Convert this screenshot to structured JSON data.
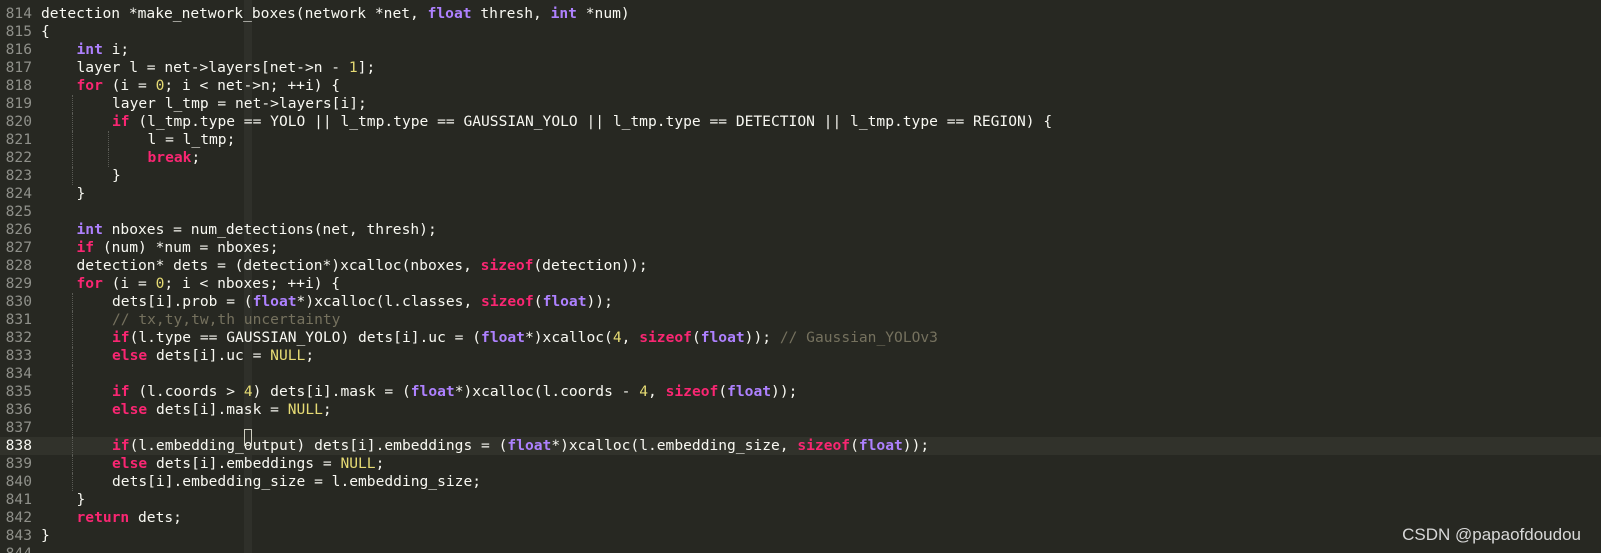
{
  "editor": {
    "colors": {
      "background": "#272822",
      "current_line": "#31322b",
      "line_number": "#8f908a",
      "plain": "#f8f8f2",
      "type": "#ae81ff",
      "keyword": "#f92672",
      "number": "#e6db74",
      "comment": "#75715e"
    },
    "current_line_number": "838",
    "watermark": "CSDN @papaofdoudou",
    "lines": [
      {
        "n": "814",
        "indent": 0,
        "tokens": [
          [
            "p",
            "detection *make_network_boxes(network *net, "
          ],
          [
            "t",
            "float"
          ],
          [
            "p",
            " thresh, "
          ],
          [
            "t",
            "int"
          ],
          [
            "p",
            " *num)"
          ]
        ]
      },
      {
        "n": "815",
        "indent": 0,
        "tokens": [
          [
            "p",
            "{"
          ]
        ]
      },
      {
        "n": "816",
        "indent": 1,
        "tokens": [
          [
            "t",
            "int"
          ],
          [
            "p",
            " i;"
          ]
        ]
      },
      {
        "n": "817",
        "indent": 1,
        "tokens": [
          [
            "p",
            "layer l = net->layers[net->n - "
          ],
          [
            "n",
            "1"
          ],
          [
            "p",
            "];"
          ]
        ]
      },
      {
        "n": "818",
        "indent": 1,
        "tokens": [
          [
            "k",
            "for"
          ],
          [
            "p",
            " (i = "
          ],
          [
            "n",
            "0"
          ],
          [
            "p",
            "; i < net->n; ++i) {"
          ]
        ]
      },
      {
        "n": "819",
        "indent": 2,
        "tokens": [
          [
            "p",
            "layer l_tmp = net->layers[i];"
          ]
        ]
      },
      {
        "n": "820",
        "indent": 2,
        "tokens": [
          [
            "k",
            "if"
          ],
          [
            "p",
            " (l_tmp.type == YOLO || l_tmp.type == GAUSSIAN_YOLO || l_tmp.type == DETECTION || l_tmp.type == REGION) {"
          ]
        ]
      },
      {
        "n": "821",
        "indent": 3,
        "tokens": [
          [
            "p",
            "l = l_tmp;"
          ]
        ]
      },
      {
        "n": "822",
        "indent": 3,
        "tokens": [
          [
            "k",
            "break"
          ],
          [
            "p",
            ";"
          ]
        ]
      },
      {
        "n": "823",
        "indent": 2,
        "tokens": [
          [
            "p",
            "}"
          ]
        ]
      },
      {
        "n": "824",
        "indent": 1,
        "tokens": [
          [
            "p",
            "}"
          ]
        ]
      },
      {
        "n": "825",
        "indent": 0,
        "tokens": []
      },
      {
        "n": "826",
        "indent": 1,
        "tokens": [
          [
            "t",
            "int"
          ],
          [
            "p",
            " nboxes = num_detections(net, thresh);"
          ]
        ]
      },
      {
        "n": "827",
        "indent": 1,
        "tokens": [
          [
            "k",
            "if"
          ],
          [
            "p",
            " (num) *num = nboxes;"
          ]
        ]
      },
      {
        "n": "828",
        "indent": 1,
        "tokens": [
          [
            "p",
            "detection* dets = (detection*)xcalloc(nboxes, "
          ],
          [
            "k",
            "sizeof"
          ],
          [
            "p",
            "(detection));"
          ]
        ]
      },
      {
        "n": "829",
        "indent": 1,
        "tokens": [
          [
            "k",
            "for"
          ],
          [
            "p",
            " (i = "
          ],
          [
            "n",
            "0"
          ],
          [
            "p",
            "; i < nboxes; ++i) {"
          ]
        ]
      },
      {
        "n": "830",
        "indent": 2,
        "tokens": [
          [
            "p",
            "dets[i].prob = ("
          ],
          [
            "t",
            "float"
          ],
          [
            "p",
            "*)xcalloc(l.classes, "
          ],
          [
            "k",
            "sizeof"
          ],
          [
            "p",
            "("
          ],
          [
            "t",
            "float"
          ],
          [
            "p",
            "));"
          ]
        ]
      },
      {
        "n": "831",
        "indent": 2,
        "tokens": [
          [
            "c",
            "// tx,ty,tw,th uncertainty"
          ]
        ]
      },
      {
        "n": "832",
        "indent": 2,
        "tokens": [
          [
            "k",
            "if"
          ],
          [
            "p",
            "(l.type == GAUSSIAN_YOLO) dets[i].uc = ("
          ],
          [
            "t",
            "float"
          ],
          [
            "p",
            "*)xcalloc("
          ],
          [
            "n",
            "4"
          ],
          [
            "p",
            ", "
          ],
          [
            "k",
            "sizeof"
          ],
          [
            "p",
            "("
          ],
          [
            "t",
            "float"
          ],
          [
            "p",
            "));"
          ],
          [
            "c",
            " // Gaussian_YOLOv3"
          ]
        ]
      },
      {
        "n": "833",
        "indent": 2,
        "tokens": [
          [
            "k",
            "else"
          ],
          [
            "p",
            " dets[i].uc = "
          ],
          [
            "n",
            "NULL"
          ],
          [
            "p",
            ";"
          ]
        ]
      },
      {
        "n": "834",
        "indent": 0,
        "tokens": []
      },
      {
        "n": "835",
        "indent": 2,
        "tokens": [
          [
            "k",
            "if"
          ],
          [
            "p",
            " (l.coords > "
          ],
          [
            "n",
            "4"
          ],
          [
            "p",
            ") dets[i].mask = ("
          ],
          [
            "t",
            "float"
          ],
          [
            "p",
            "*)xcalloc(l.coords - "
          ],
          [
            "n",
            "4"
          ],
          [
            "p",
            ", "
          ],
          [
            "k",
            "sizeof"
          ],
          [
            "p",
            "("
          ],
          [
            "t",
            "float"
          ],
          [
            "p",
            "));"
          ]
        ]
      },
      {
        "n": "836",
        "indent": 2,
        "tokens": [
          [
            "k",
            "else"
          ],
          [
            "p",
            " dets[i].mask = "
          ],
          [
            "n",
            "NULL"
          ],
          [
            "p",
            ";"
          ]
        ]
      },
      {
        "n": "837",
        "indent": 0,
        "tokens": []
      },
      {
        "n": "838",
        "indent": 2,
        "tokens": [
          [
            "k",
            "if"
          ],
          [
            "p",
            "(l.embedding_output) dets[i].embeddings = ("
          ],
          [
            "t",
            "float"
          ],
          [
            "p",
            "*)xcalloc(l.embedding_size, "
          ],
          [
            "k",
            "sizeof"
          ],
          [
            "p",
            "("
          ],
          [
            "t",
            "float"
          ],
          [
            "p",
            "));"
          ]
        ]
      },
      {
        "n": "839",
        "indent": 2,
        "tokens": [
          [
            "k",
            "else"
          ],
          [
            "p",
            " dets[i].embeddings = "
          ],
          [
            "n",
            "NULL"
          ],
          [
            "p",
            ";"
          ]
        ]
      },
      {
        "n": "840",
        "indent": 2,
        "tokens": [
          [
            "p",
            "dets[i].embedding_size = l.embedding_size;"
          ]
        ]
      },
      {
        "n": "841",
        "indent": 1,
        "tokens": [
          [
            "p",
            "}"
          ]
        ]
      },
      {
        "n": "842",
        "indent": 1,
        "tokens": [
          [
            "k",
            "return"
          ],
          [
            "p",
            " dets;"
          ]
        ]
      },
      {
        "n": "843",
        "indent": 0,
        "tokens": [
          [
            "p",
            "}"
          ]
        ]
      },
      {
        "n": "844",
        "indent": 0,
        "tokens": []
      }
    ]
  }
}
